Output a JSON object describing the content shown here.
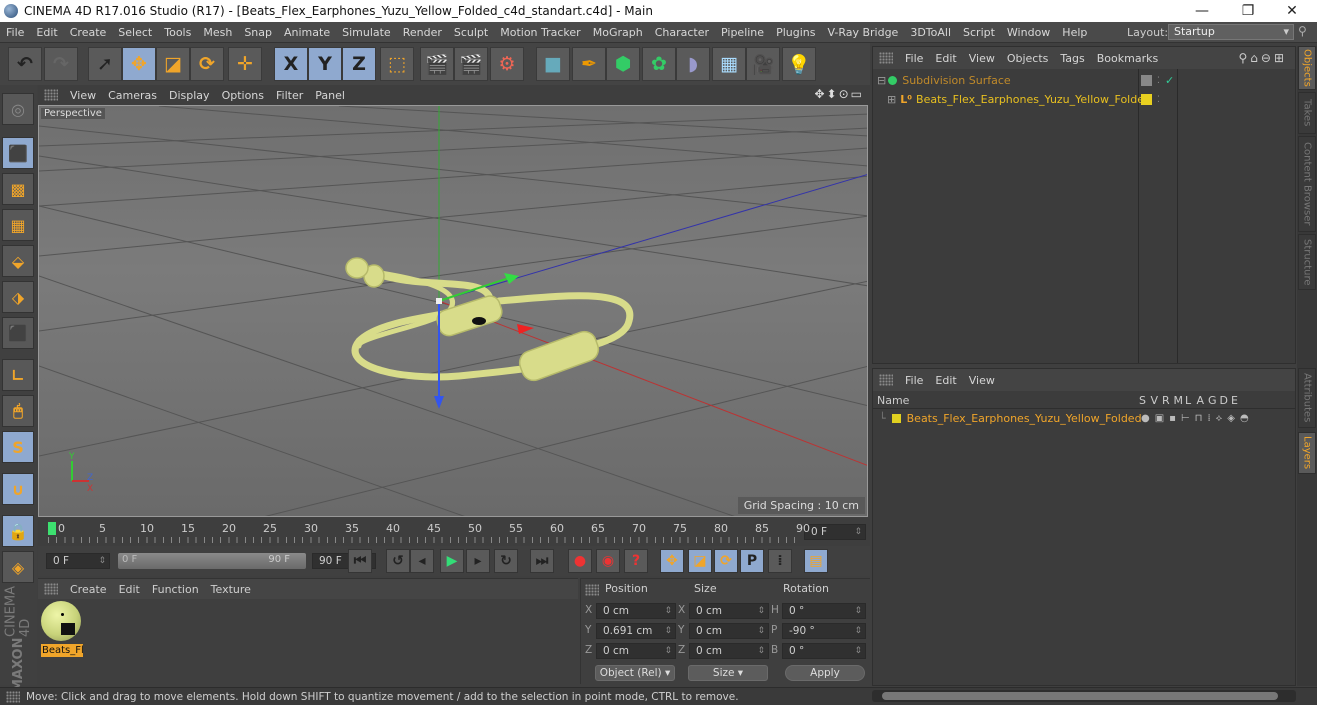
{
  "window": {
    "title": "CINEMA 4D R17.016 Studio (R17) - [Beats_Flex_Earphones_Yuzu_Yellow_Folded_c4d_standart.c4d] - Main",
    "controls": {
      "minimize": "—",
      "restore": "❐",
      "close": "✕"
    }
  },
  "menubar": {
    "items": [
      "File",
      "Edit",
      "Create",
      "Select",
      "Tools",
      "Mesh",
      "Snap",
      "Animate",
      "Simulate",
      "Render",
      "Sculpt",
      "Motion Tracker",
      "MoGraph",
      "Character",
      "Pipeline",
      "Plugins",
      "V-Ray Bridge",
      "3DToAll",
      "Script",
      "Window",
      "Help"
    ],
    "layout_label": "Layout:",
    "layout_value": "Startup"
  },
  "toolbar": {
    "buttons": [
      {
        "name": "undo",
        "glyph": "↶"
      },
      {
        "name": "redo",
        "glyph": "↷"
      },
      {
        "name": "live-selection",
        "glyph": "➚"
      },
      {
        "name": "move",
        "glyph": "✥"
      },
      {
        "name": "scale",
        "glyph": "◪"
      },
      {
        "name": "rotate",
        "glyph": "⟳"
      },
      {
        "name": "recent-tool",
        "glyph": "✛"
      },
      {
        "name": "x-axis",
        "glyph": "X"
      },
      {
        "name": "y-axis",
        "glyph": "Y"
      },
      {
        "name": "z-axis",
        "glyph": "Z"
      },
      {
        "name": "coordinate-system",
        "glyph": "⬚"
      },
      {
        "name": "render-view",
        "glyph": "🎬"
      },
      {
        "name": "render-picture-viewer",
        "glyph": "🎬"
      },
      {
        "name": "render-settings",
        "glyph": "⚙"
      },
      {
        "name": "cube",
        "glyph": "■"
      },
      {
        "name": "pen",
        "glyph": "✒"
      },
      {
        "name": "subdivision",
        "glyph": "⬢"
      },
      {
        "name": "mograph-cloner",
        "glyph": "✿"
      },
      {
        "name": "deformer",
        "glyph": "◗"
      },
      {
        "name": "floor",
        "glyph": "▦"
      },
      {
        "name": "camera",
        "glyph": "🎥"
      },
      {
        "name": "light",
        "glyph": "💡"
      }
    ]
  },
  "viewport": {
    "menu": [
      "View",
      "Cameras",
      "Display",
      "Options",
      "Filter",
      "Panel"
    ],
    "label": "Perspective",
    "grid_spacing": "Grid Spacing : 10 cm",
    "nav_icons": "✥⬍⊙▭"
  },
  "left_tools": [
    {
      "name": "make-editable",
      "glyph": "◎"
    },
    {
      "name": "model-mode",
      "glyph": "⬛"
    },
    {
      "name": "texture-mode",
      "glyph": "▩"
    },
    {
      "name": "workplane-mode",
      "glyph": "▦"
    },
    {
      "name": "points-mode",
      "glyph": "⬙"
    },
    {
      "name": "edges-mode",
      "glyph": "⬗"
    },
    {
      "name": "polygons-mode",
      "glyph": "⬛"
    },
    {
      "name": "axis-mode",
      "glyph": "∟"
    },
    {
      "name": "tweak-mode",
      "glyph": "🖱"
    },
    {
      "name": "solo-mode",
      "glyph": "S"
    },
    {
      "name": "snap",
      "glyph": "∪"
    },
    {
      "name": "workplane-lock",
      "glyph": "🔒"
    },
    {
      "name": "workplane-align",
      "glyph": "◈"
    }
  ],
  "brand": {
    "line1": "MAXON",
    "line2": "CINEMA 4D"
  },
  "timeline": {
    "ticks": [
      "0",
      "5",
      "10",
      "15",
      "20",
      "25",
      "30",
      "35",
      "40",
      "45",
      "50",
      "55",
      "60",
      "65",
      "70",
      "75",
      "80",
      "85",
      "90"
    ],
    "current_frame": "0 F",
    "start": "0 F",
    "range_start": "0 F",
    "range_end": "90 F",
    "end": "90 F"
  },
  "playback": {
    "buttons": [
      {
        "name": "go-to-start",
        "glyph": "⏮"
      },
      {
        "name": "previous-key",
        "glyph": "↺"
      },
      {
        "name": "previous-frame",
        "glyph": "◂"
      },
      {
        "name": "play",
        "glyph": "▶"
      },
      {
        "name": "next-frame",
        "glyph": "▸"
      },
      {
        "name": "next-key",
        "glyph": "↻"
      },
      {
        "name": "go-to-end",
        "glyph": "⏭"
      },
      {
        "name": "record",
        "glyph": "●"
      },
      {
        "name": "autokey",
        "glyph": "◉"
      },
      {
        "name": "keyframe-selection",
        "glyph": "?"
      },
      {
        "name": "key-position",
        "glyph": "✥"
      },
      {
        "name": "key-scale",
        "glyph": "◪"
      },
      {
        "name": "key-rotation",
        "glyph": "⟳"
      },
      {
        "name": "key-param",
        "glyph": "P"
      },
      {
        "name": "key-pla",
        "glyph": "⁞"
      },
      {
        "name": "timeline-window",
        "glyph": "▤"
      }
    ]
  },
  "material_panel": {
    "menu": [
      "Create",
      "Edit",
      "Function",
      "Texture"
    ],
    "materials": [
      {
        "label": "Beats_Fl"
      }
    ]
  },
  "coordinates": {
    "headers": {
      "position": "Position",
      "size": "Size",
      "rotation": "Rotation"
    },
    "position": [
      {
        "axis": "X",
        "value": "0 cm"
      },
      {
        "axis": "Y",
        "value": "0.691 cm"
      },
      {
        "axis": "Z",
        "value": "0 cm"
      }
    ],
    "size": [
      {
        "axis": "X",
        "value": "0 cm"
      },
      {
        "axis": "Y",
        "value": "0 cm"
      },
      {
        "axis": "Z",
        "value": "0 cm"
      }
    ],
    "rotation": [
      {
        "axis": "H",
        "value": "0 °"
      },
      {
        "axis": "P",
        "value": "-90 °"
      },
      {
        "axis": "B",
        "value": "0 °"
      }
    ],
    "mode_select": "Object (Rel)",
    "size_select": "Size",
    "apply": "Apply"
  },
  "objects_panel": {
    "menu": [
      "File",
      "Edit",
      "View",
      "Objects",
      "Tags",
      "Bookmarks"
    ],
    "objects": [
      {
        "name": "Subdivision Surface",
        "color": "#c08a2a",
        "expand": "⊟"
      },
      {
        "name": "Beats_Flex_Earphones_Yuzu_Yellow_Folded",
        "color": "#e8c020",
        "expand": "⊞"
      }
    ]
  },
  "layers_panel": {
    "menu": [
      "File",
      "Edit",
      "View"
    ],
    "columns": [
      "Name",
      "S",
      "V",
      "R",
      "M",
      "L",
      "A",
      "G",
      "D",
      "E"
    ],
    "layers": [
      {
        "name": "Beats_Flex_Earphones_Yuzu_Yellow_Folded",
        "color": "#e0d020"
      }
    ]
  },
  "side_tabs": {
    "top": [
      {
        "label": "Objects",
        "active": true
      },
      {
        "label": "Takes",
        "active": false
      },
      {
        "label": "Content Browser",
        "active": false
      },
      {
        "label": "Structure",
        "active": false
      }
    ],
    "bottom": [
      {
        "label": "Attributes",
        "active": false
      },
      {
        "label": "Layers",
        "active": true
      }
    ]
  },
  "status": {
    "text": "Move: Click and drag to move elements. Hold down SHIFT to quantize movement / add to the selection in point mode, CTRL to remove."
  },
  "colors": {
    "accent_orange": "#f0a52a",
    "selected_blue": "#8fa9cf",
    "model_yellow": "#d8dc8a"
  }
}
